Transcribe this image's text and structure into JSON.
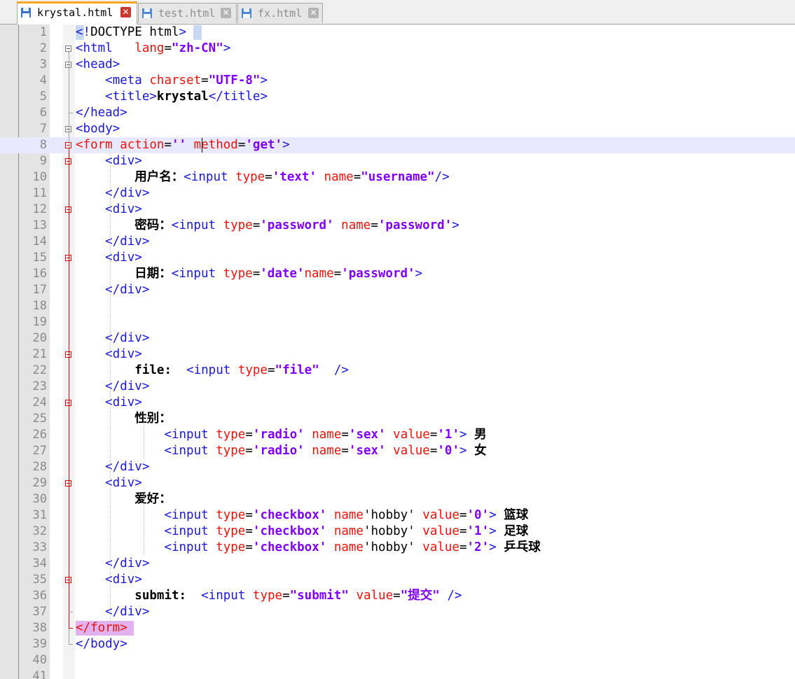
{
  "tabs": [
    {
      "label": "krystal.html",
      "active": true,
      "icon": "save-disk-icon",
      "close": "close-icon"
    },
    {
      "label": "test.html",
      "active": false,
      "icon": "save-disk-icon",
      "close": "close-icon"
    },
    {
      "label": "fx.html",
      "active": false,
      "icon": "save-disk-icon",
      "close": "close-icon"
    }
  ],
  "colors": {
    "tag": "#1a19d9",
    "attribute": "#e8140c",
    "value": "#8000ff",
    "current_line": "#e8e8ff",
    "active_tab_accent": "#f5a623"
  },
  "editor": {
    "current_line": 8,
    "lines": [
      {
        "n": "1",
        "tokens": [
          [
            "tag",
            "<!"
          ],
          [
            "txt",
            "DOCTYPE html"
          ],
          [
            "tag",
            ">"
          ]
        ]
      },
      {
        "n": "2",
        "tokens": [
          [
            "tag",
            "<html"
          ],
          [
            "txt",
            "   "
          ],
          [
            "attr",
            "lang"
          ],
          [
            "txt",
            "="
          ],
          [
            "val",
            "\"zh-CN\""
          ],
          [
            "tag",
            ">"
          ]
        ]
      },
      {
        "n": "3",
        "tokens": [
          [
            "tag",
            "<head>"
          ]
        ]
      },
      {
        "n": "4",
        "tokens": [
          [
            "txt",
            "    "
          ],
          [
            "tag",
            "<meta "
          ],
          [
            "attr",
            "charset"
          ],
          [
            "txt",
            "="
          ],
          [
            "val",
            "\"UTF-8\""
          ],
          [
            "tag",
            ">"
          ]
        ]
      },
      {
        "n": "5",
        "tokens": [
          [
            "txt",
            "    "
          ],
          [
            "tag",
            "<title>"
          ],
          [
            "bold",
            "krystal"
          ],
          [
            "tag",
            "</title>"
          ]
        ]
      },
      {
        "n": "6",
        "tokens": [
          [
            "tag",
            "</head>"
          ]
        ]
      },
      {
        "n": "7",
        "tokens": [
          [
            "tag",
            "<body>"
          ]
        ]
      },
      {
        "n": "8",
        "tokens": [
          [
            "attr",
            "<form "
          ],
          [
            "attr",
            "action"
          ],
          [
            "txt",
            "="
          ],
          [
            "val",
            "''"
          ],
          [
            "txt",
            " "
          ],
          [
            "attr",
            "method"
          ],
          [
            "txt",
            "="
          ],
          [
            "val",
            "'get'"
          ],
          [
            "tag",
            ">"
          ]
        ]
      },
      {
        "n": "9",
        "tokens": [
          [
            "txt",
            "    "
          ],
          [
            "tag",
            "<div>"
          ]
        ]
      },
      {
        "n": "10",
        "tokens": [
          [
            "txt",
            "        "
          ],
          [
            "bold",
            "用户名："
          ],
          [
            "tag",
            "<input "
          ],
          [
            "attr",
            "type"
          ],
          [
            "txt",
            "="
          ],
          [
            "val",
            "'text'"
          ],
          [
            "txt",
            " "
          ],
          [
            "attr",
            "name"
          ],
          [
            "txt",
            "="
          ],
          [
            "val",
            "\"username\""
          ],
          [
            "tag",
            "/>"
          ]
        ]
      },
      {
        "n": "11",
        "tokens": [
          [
            "txt",
            "    "
          ],
          [
            "tag",
            "</div>"
          ]
        ]
      },
      {
        "n": "12",
        "tokens": [
          [
            "txt",
            "    "
          ],
          [
            "tag",
            "<div>"
          ]
        ]
      },
      {
        "n": "13",
        "tokens": [
          [
            "txt",
            "        "
          ],
          [
            "bold",
            "密码："
          ],
          [
            "tag",
            "<input "
          ],
          [
            "attr",
            "type"
          ],
          [
            "txt",
            "="
          ],
          [
            "val",
            "'password'"
          ],
          [
            "txt",
            " "
          ],
          [
            "attr",
            "name"
          ],
          [
            "txt",
            "="
          ],
          [
            "val",
            "'password'"
          ],
          [
            "tag",
            ">"
          ]
        ]
      },
      {
        "n": "14",
        "tokens": [
          [
            "txt",
            "    "
          ],
          [
            "tag",
            "</div>"
          ]
        ]
      },
      {
        "n": "15",
        "tokens": [
          [
            "txt",
            "    "
          ],
          [
            "tag",
            "<div>"
          ]
        ]
      },
      {
        "n": "16",
        "tokens": [
          [
            "txt",
            "        "
          ],
          [
            "bold",
            "日期："
          ],
          [
            "tag",
            "<input "
          ],
          [
            "attr",
            "type"
          ],
          [
            "txt",
            "="
          ],
          [
            "val",
            "'date'"
          ],
          [
            "attr",
            "name"
          ],
          [
            "txt",
            "="
          ],
          [
            "val",
            "'password'"
          ],
          [
            "tag",
            ">"
          ]
        ]
      },
      {
        "n": "17",
        "tokens": [
          [
            "txt",
            "    "
          ],
          [
            "tag",
            "</div>"
          ]
        ]
      },
      {
        "n": "18",
        "tokens": []
      },
      {
        "n": "19",
        "tokens": []
      },
      {
        "n": "20",
        "tokens": [
          [
            "txt",
            "    "
          ],
          [
            "tag",
            "</div>"
          ]
        ]
      },
      {
        "n": "21",
        "tokens": [
          [
            "txt",
            "    "
          ],
          [
            "tag",
            "<div>"
          ]
        ]
      },
      {
        "n": "22",
        "tokens": [
          [
            "txt",
            "        "
          ],
          [
            "bold",
            "file:"
          ],
          [
            "txt",
            "  "
          ],
          [
            "tag",
            "<input "
          ],
          [
            "attr",
            "type"
          ],
          [
            "txt",
            "="
          ],
          [
            "val",
            "\"file\""
          ],
          [
            "txt",
            "  "
          ],
          [
            "tag",
            "/>"
          ]
        ]
      },
      {
        "n": "23",
        "tokens": [
          [
            "txt",
            "    "
          ],
          [
            "tag",
            "</div>"
          ]
        ]
      },
      {
        "n": "24",
        "tokens": [
          [
            "txt",
            "    "
          ],
          [
            "tag",
            "<div>"
          ]
        ]
      },
      {
        "n": "25",
        "tokens": [
          [
            "txt",
            "        "
          ],
          [
            "bold",
            "性别："
          ]
        ]
      },
      {
        "n": "26",
        "tokens": [
          [
            "txt",
            "            "
          ],
          [
            "tag",
            "<input "
          ],
          [
            "attr",
            "type"
          ],
          [
            "txt",
            "="
          ],
          [
            "val",
            "'radio'"
          ],
          [
            "txt",
            " "
          ],
          [
            "attr",
            "name"
          ],
          [
            "txt",
            "="
          ],
          [
            "val",
            "'sex'"
          ],
          [
            "txt",
            " "
          ],
          [
            "attr",
            "value"
          ],
          [
            "txt",
            "="
          ],
          [
            "val",
            "'1'"
          ],
          [
            "tag",
            ">"
          ],
          [
            "bold",
            " 男"
          ]
        ]
      },
      {
        "n": "27",
        "tokens": [
          [
            "txt",
            "            "
          ],
          [
            "tag",
            "<input "
          ],
          [
            "attr",
            "type"
          ],
          [
            "txt",
            "="
          ],
          [
            "val",
            "'radio'"
          ],
          [
            "txt",
            " "
          ],
          [
            "attr",
            "name"
          ],
          [
            "txt",
            "="
          ],
          [
            "val",
            "'sex'"
          ],
          [
            "txt",
            " "
          ],
          [
            "attr",
            "value"
          ],
          [
            "txt",
            "="
          ],
          [
            "val",
            "'0'"
          ],
          [
            "tag",
            ">"
          ],
          [
            "bold",
            " 女"
          ]
        ]
      },
      {
        "n": "28",
        "tokens": [
          [
            "txt",
            "    "
          ],
          [
            "tag",
            "</div>"
          ]
        ]
      },
      {
        "n": "29",
        "tokens": [
          [
            "txt",
            "    "
          ],
          [
            "tag",
            "<div>"
          ]
        ]
      },
      {
        "n": "30",
        "tokens": [
          [
            "txt",
            "        "
          ],
          [
            "bold",
            "爱好："
          ]
        ]
      },
      {
        "n": "31",
        "tokens": [
          [
            "txt",
            "            "
          ],
          [
            "tag",
            "<input "
          ],
          [
            "attr",
            "type"
          ],
          [
            "txt",
            "="
          ],
          [
            "val",
            "'checkbox'"
          ],
          [
            "txt",
            " "
          ],
          [
            "attr",
            "name"
          ],
          [
            "txt",
            "'hobby'"
          ],
          [
            "txt",
            " "
          ],
          [
            "attr",
            "value"
          ],
          [
            "txt",
            "="
          ],
          [
            "val",
            "'0'"
          ],
          [
            "tag",
            ">"
          ],
          [
            "bold",
            " 篮球"
          ]
        ]
      },
      {
        "n": "32",
        "tokens": [
          [
            "txt",
            "            "
          ],
          [
            "tag",
            "<input "
          ],
          [
            "attr",
            "type"
          ],
          [
            "txt",
            "="
          ],
          [
            "val",
            "'checkbox'"
          ],
          [
            "txt",
            " "
          ],
          [
            "attr",
            "name"
          ],
          [
            "txt",
            "'hobby'"
          ],
          [
            "txt",
            " "
          ],
          [
            "attr",
            "value"
          ],
          [
            "txt",
            "="
          ],
          [
            "val",
            "'1'"
          ],
          [
            "tag",
            ">"
          ],
          [
            "bold",
            " 足球"
          ]
        ]
      },
      {
        "n": "33",
        "tokens": [
          [
            "txt",
            "            "
          ],
          [
            "tag",
            "<input "
          ],
          [
            "attr",
            "type"
          ],
          [
            "txt",
            "="
          ],
          [
            "val",
            "'checkbox'"
          ],
          [
            "txt",
            " "
          ],
          [
            "attr",
            "name"
          ],
          [
            "txt",
            "'hobby'"
          ],
          [
            "txt",
            " "
          ],
          [
            "attr",
            "value"
          ],
          [
            "txt",
            "="
          ],
          [
            "val",
            "'2'"
          ],
          [
            "tag",
            ">"
          ],
          [
            "bold",
            " 乒乓球"
          ]
        ]
      },
      {
        "n": "34",
        "tokens": [
          [
            "txt",
            "    "
          ],
          [
            "tag",
            "</div>"
          ]
        ]
      },
      {
        "n": "35",
        "tokens": [
          [
            "txt",
            "    "
          ],
          [
            "tag",
            "<div>"
          ]
        ]
      },
      {
        "n": "36",
        "tokens": [
          [
            "txt",
            "        "
          ],
          [
            "bold",
            "submit:"
          ],
          [
            "txt",
            "  "
          ],
          [
            "tag",
            "<input "
          ],
          [
            "attr",
            "type"
          ],
          [
            "txt",
            "="
          ],
          [
            "val",
            "\"submit\""
          ],
          [
            "txt",
            " "
          ],
          [
            "attr",
            "value"
          ],
          [
            "txt",
            "="
          ],
          [
            "val",
            "\"提交\""
          ],
          [
            "txt",
            " "
          ],
          [
            "tag",
            "/>"
          ]
        ]
      },
      {
        "n": "37",
        "tokens": [
          [
            "txt",
            "    "
          ],
          [
            "tag",
            "</div>"
          ]
        ]
      },
      {
        "n": "38",
        "tokens": [
          [
            "attr",
            "</form>"
          ]
        ]
      },
      {
        "n": "39",
        "tokens": [
          [
            "tag",
            "</body>"
          ]
        ]
      },
      {
        "n": "40",
        "tokens": []
      },
      {
        "n": "41",
        "tokens": []
      }
    ]
  }
}
